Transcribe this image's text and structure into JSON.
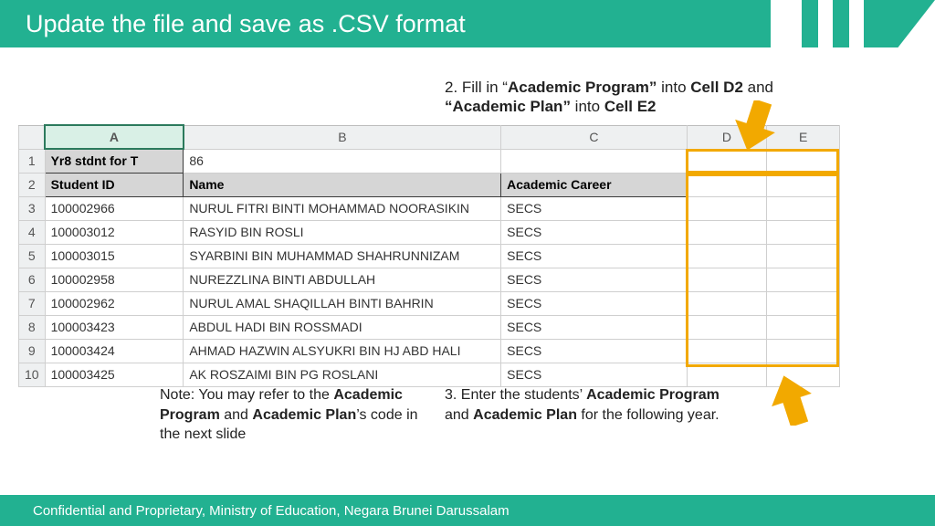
{
  "title": "Update the file and save as .CSV format",
  "step2_pre": "2. Fill in “",
  "step2_b1": "Academic Program”",
  "step2_mid1": " into ",
  "step2_b2": "Cell D2",
  "step2_mid2": " and ",
  "step2_b3": "“Academic Plan”",
  "step2_mid3": " into ",
  "step2_b4": "Cell E2",
  "columns": {
    "A": "A",
    "B": "B",
    "C": "C",
    "D": "D",
    "E": "E"
  },
  "row1": {
    "A": "Yr8 stdnt for T",
    "B": "86"
  },
  "row2": {
    "A": "Student ID",
    "B": "Name",
    "C": "Academic Career"
  },
  "rows": [
    {
      "n": "3",
      "id": "100002966",
      "name": "NURUL FITRI BINTI MOHAMMAD NOORASIKIN",
      "career": "SECS"
    },
    {
      "n": "4",
      "id": "100003012",
      "name": "RASYID BIN ROSLI",
      "career": "SECS"
    },
    {
      "n": "5",
      "id": "100003015",
      "name": "SYARBINI BIN MUHAMMAD SHAHRUNNIZAM",
      "career": "SECS"
    },
    {
      "n": "6",
      "id": "100002958",
      "name": "NUREZZLINA BINTI ABDULLAH",
      "career": "SECS"
    },
    {
      "n": "7",
      "id": "100002962",
      "name": "NURUL AMAL SHAQILLAH BINTI BAHRIN",
      "career": "SECS"
    },
    {
      "n": "8",
      "id": "100003423",
      "name": "ABDUL HADI BIN ROSSMADI",
      "career": "SECS"
    },
    {
      "n": "9",
      "id": "100003424",
      "name": "AHMAD HAZWIN ALSYUKRI BIN HJ ABD HALI",
      "career": "SECS"
    },
    {
      "n": "10",
      "id": "100003425",
      "name": "AK ROSZAIMI BIN PG ROSLANI",
      "career": "SECS"
    }
  ],
  "note_left_pre": "Note: You may refer to the ",
  "note_left_b1": "Academic Program",
  "note_left_mid": " and ",
  "note_left_b2": "Academic Plan",
  "note_left_post": "’s code in the next slide",
  "note_right_pre": "3. Enter the students’ ",
  "note_right_b1": "Academic Program",
  "note_right_mid": " and ",
  "note_right_b2": "Academic Plan",
  "note_right_post": " for the following year.",
  "footer": "Confidential and Proprietary, Ministry of Education, Negara Brunei Darussalam",
  "accent": "#f2a900"
}
